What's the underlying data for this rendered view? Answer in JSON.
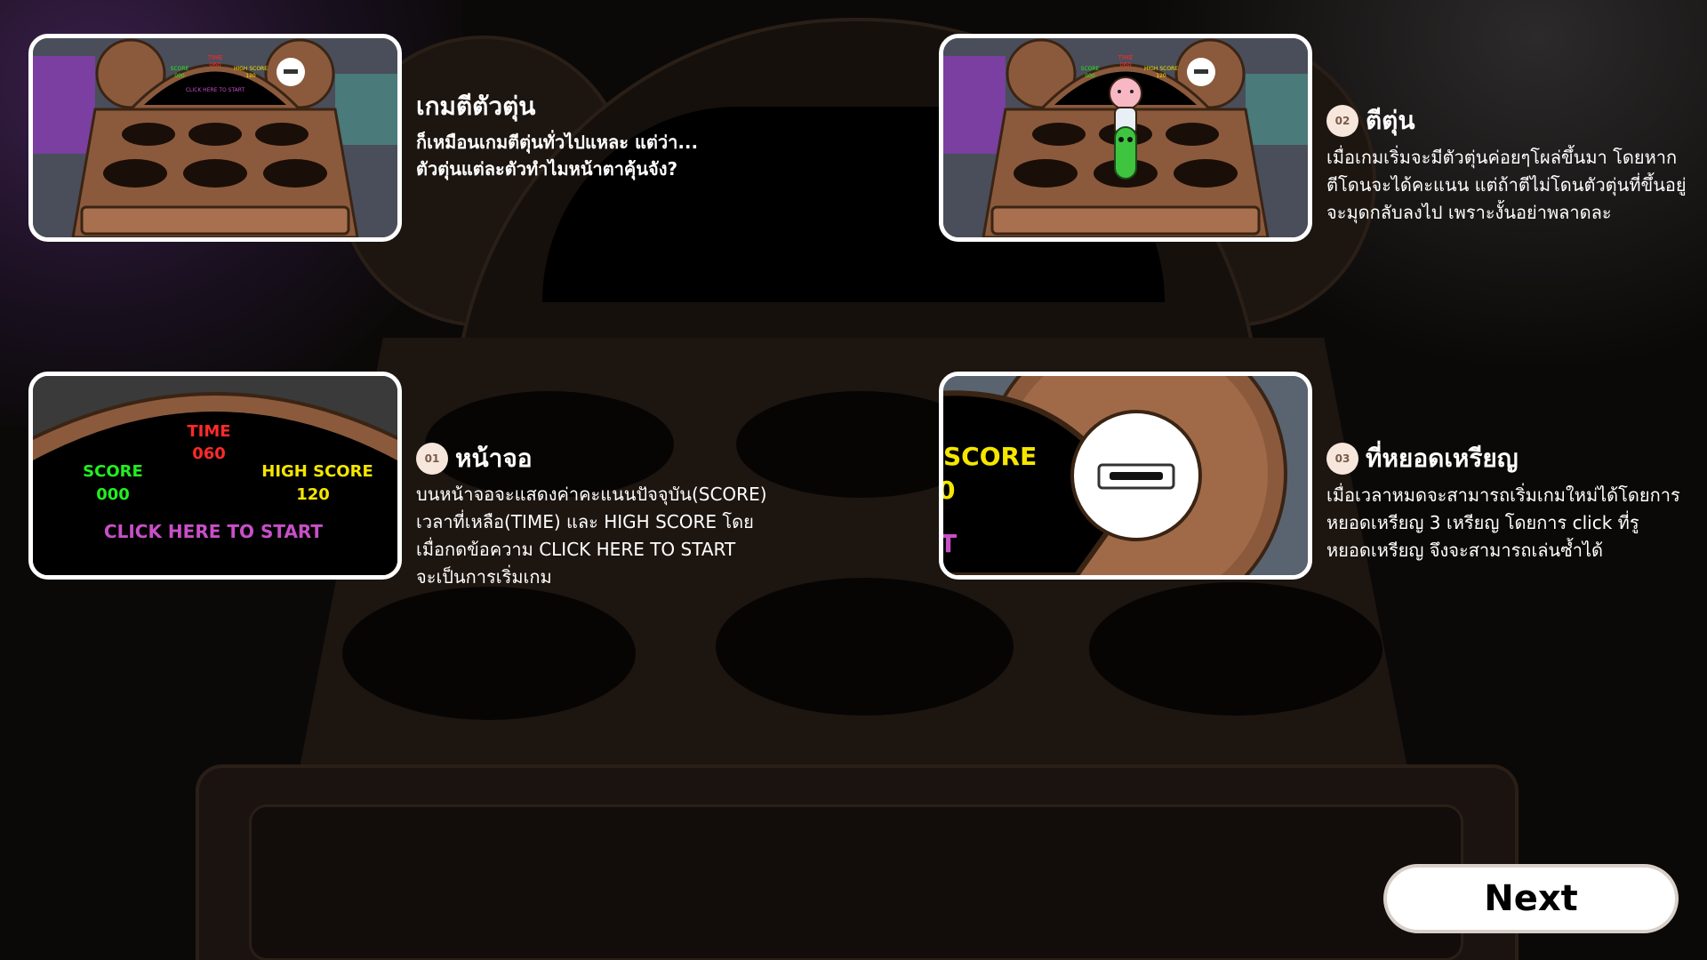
{
  "intro": {
    "title": "เกมตีตัวตุ่น",
    "subtitle_line1": "ก็เหมือนเกมตีตุ่นทั่วไปแหละ แต่ว่า...",
    "subtitle_line2": "ตัวตุ่นแต่ละตัวทำไมหน้าตาคุ้นจัง?"
  },
  "screen_thumb": {
    "time_label": "TIME",
    "time_value": "060",
    "score_label": "SCORE",
    "score_value": "000",
    "high_label": "HIGH SCORE",
    "high_value": "120",
    "start_text": "CLICK HERE TO START"
  },
  "coin_thumb": {
    "fragment_score": "SCORE",
    "fragment_zero": "0",
    "fragment_t": "T"
  },
  "sections": [
    {
      "num": "01",
      "title": "หน้าจอ",
      "lines": [
        "บนหน้าจอจะแสดงค่าคะแนนปัจจุบัน(SCORE)",
        "เวลาที่เหลือ(TIME) และ HIGH SCORE โดย",
        "เมื่อกดข้อความ CLICK HERE TO START",
        "จะเป็นการเริ่มเกม"
      ]
    },
    {
      "num": "02",
      "title": "ตีตุ่น",
      "lines": [
        "เมื่อเกมเริ่มจะมีตัวตุ่นค่อยๆโผล่ขึ้นมา โดยหาก",
        "ตีโดนจะได้คะแนน แต่ถ้าตีไม่โดนตัวตุ่นที่ขึ้นอยู่",
        "จะมุดกลับลงไป เพราะงั้นอย่าพลาดละ"
      ]
    },
    {
      "num": "03",
      "title": "ที่หยอดเหรียญ",
      "lines": [
        "เมื่อเวลาหมดจะสามารถเริ่มเกมใหม่ได้โดยการ",
        "หยอดเหรียญ 3 เหรียญ โดยการ click ที่รู",
        "หยอดเหรียญ จึงจะสามารถเล่นซ้ำได้"
      ]
    }
  ],
  "next_label": "Next",
  "colors": {
    "machine_brown": "#8b5a3c",
    "time_red": "#ff2a2a",
    "score_green": "#22ee22",
    "highscore_yellow": "#f5e600",
    "start_magenta": "#c84fc8",
    "badge_bg": "#f7e6dc"
  }
}
